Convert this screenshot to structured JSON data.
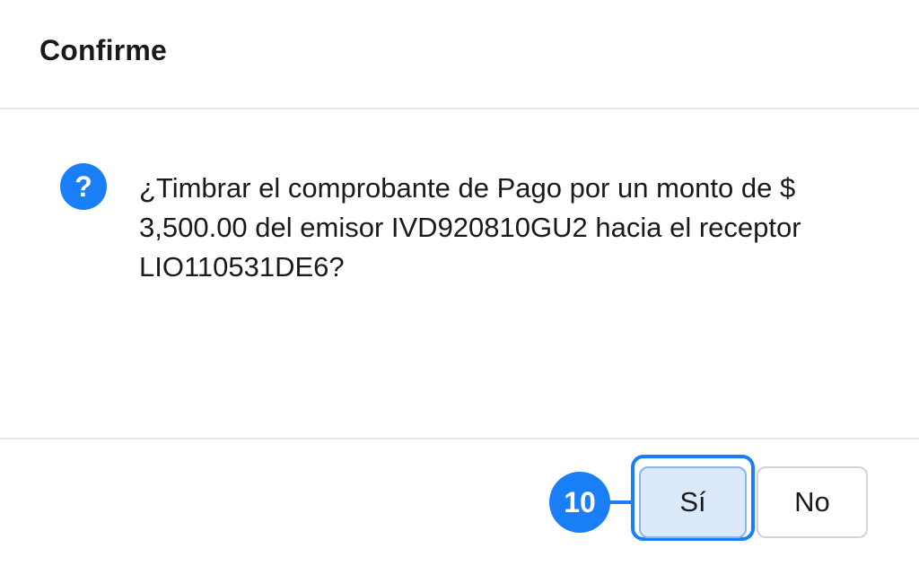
{
  "dialog": {
    "title": "Confirme",
    "icon": "question-icon",
    "icon_glyph": "?",
    "message": "¿Timbrar el comprobante de Pago por un monto de $ 3,500.00 del emisor IVD920810GU2 hacia el receptor LIO110531DE6?"
  },
  "buttons": {
    "yes_label": "Sí",
    "no_label": "No"
  },
  "step_badge": {
    "number": "10"
  },
  "colors": {
    "accent": "#1a7ef6",
    "yes_button_bg": "#dce9fb",
    "divider": "#e6e6e6"
  }
}
